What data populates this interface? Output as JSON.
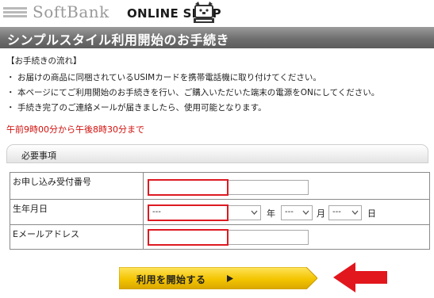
{
  "header": {
    "brand": "SoftBank",
    "shop": "ONLINE SHOP",
    "mascot_icon": "dog-mascot-icon"
  },
  "title": "シンプルスタイル利用開始のお手続き",
  "flow": {
    "heading": "【お手続きの流れ】",
    "bullet": "・",
    "items": [
      "お届けの商品に同梱されているUSIMカードを携帯電話機に取り付けてください。",
      "本ページにてご利用開始のお手続きを行い、ご購入いただいた端末の電源をONにしてください。",
      "手続き完了のご連絡メールが届きましたら、使用可能となります。"
    ]
  },
  "hours": "午前9時00分から午後8時30分まで",
  "section": {
    "title": "必要事項"
  },
  "form": {
    "order_number": {
      "label": "お申し込み受付番号",
      "value": ""
    },
    "birthdate": {
      "label": "生年月日",
      "year": "---",
      "year_unit": "年",
      "month": "---",
      "month_unit": "月",
      "day": "---",
      "day_unit": "日"
    },
    "email": {
      "label": "Eメールアドレス",
      "value": ""
    }
  },
  "start_button": {
    "label": "利用を開始する"
  },
  "colors": {
    "title_bar": "#6f6f6f",
    "highlight_red": "#dd1a22",
    "hours_red": "#d0100c",
    "button_yellow": "#f3c400"
  }
}
